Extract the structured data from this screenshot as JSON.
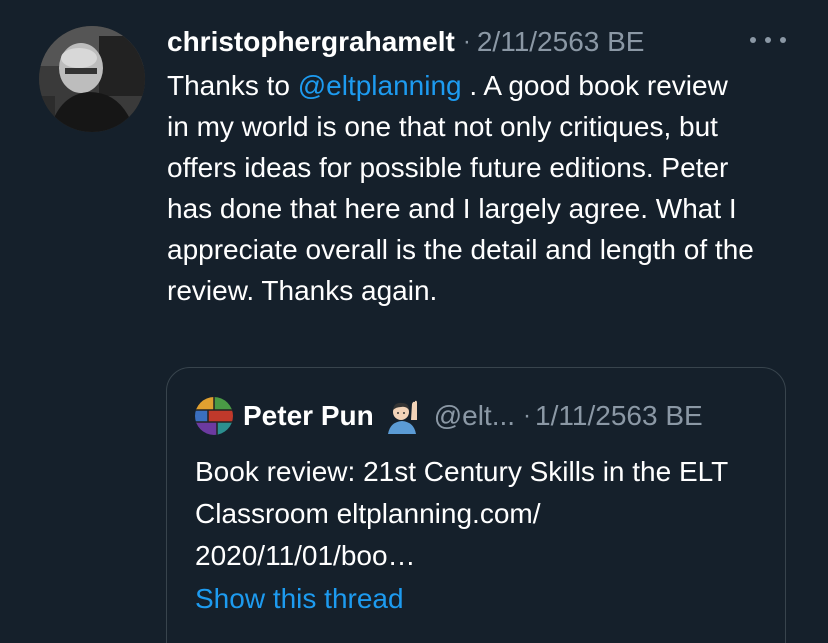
{
  "tweet": {
    "username": "christophergrahamelt",
    "separator": "·",
    "date": "2/11/2563 BE",
    "more_icon": "more-horizontal-icon",
    "text_before_mention": "Thanks to ",
    "mention": "@eltplanning",
    "text_after_mention": " . A good book review in my world is one that not only critiques, but offers ideas for possible future editions. Peter has done that here and I largely agree. What I appreciate overall is the detail and length of the review. Thanks again."
  },
  "quoted_tweet": {
    "name": "Peter Pun",
    "emoji": "person-raising-hand-emoji",
    "handle": "@elt...",
    "separator": "·",
    "date": "1/11/2563 BE",
    "text": "Book review: 21st Century Skills in the ELT Classroom eltplanning.com/ 2020/11/01/boo…",
    "show_thread": "Show this thread"
  },
  "colors": {
    "background": "#15202b",
    "text": "#ffffff",
    "secondary": "#8b98a5",
    "link": "#1d9bf0",
    "border": "#38444d"
  }
}
